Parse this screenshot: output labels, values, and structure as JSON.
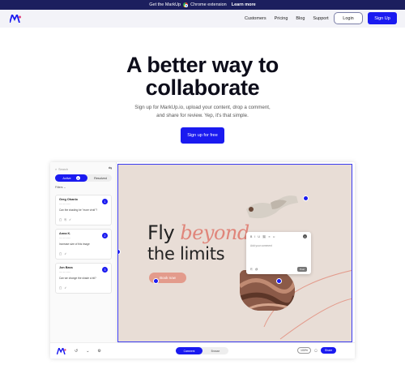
{
  "announce": {
    "text": "Get the MarkUp",
    "ext": "Chrome extension",
    "learn": "Learn more"
  },
  "nav": {
    "links": [
      "Customers",
      "Pricing",
      "Blog",
      "Support"
    ],
    "login": "Login",
    "signup": "Sign Up"
  },
  "hero": {
    "title_line1": "A better way to",
    "title_line2": "collaborate",
    "sub_line1": "Sign up for MarkUp.io, upload your content, drop a comment,",
    "sub_line2": "and share for review. Yep, it's that simple.",
    "cta": "Sign up for free"
  },
  "app": {
    "sidebar": {
      "search": "Search",
      "tab_active": "Active",
      "tab_active_count": "3",
      "tab_inactive": "Resolved",
      "filter": "Filters",
      "comments": [
        {
          "name": "Greg Ohanlo",
          "meta": "~~ ~~ ~~~",
          "text": "Can the shading be \"more vivid\"?",
          "pin": "1"
        },
        {
          "name": "Anna K.",
          "meta": "~~ ~~ ~~~",
          "text": "Increase size of this image",
          "pin": "2"
        },
        {
          "name": "Jon Bass",
          "meta": "~~ ~~ ~~~",
          "text": "Can we change the shade a bit?",
          "pin": "3"
        }
      ]
    },
    "canvas": {
      "fly": "Fly",
      "beyond": "beyond",
      "limits": "the limits",
      "book": "Book now",
      "comment_placeholder": "Add your comment",
      "post": "Post"
    },
    "toolbar": {
      "mode_on": "Comment",
      "mode_off": "Browse",
      "zoom": "100%",
      "share": "Share"
    }
  }
}
